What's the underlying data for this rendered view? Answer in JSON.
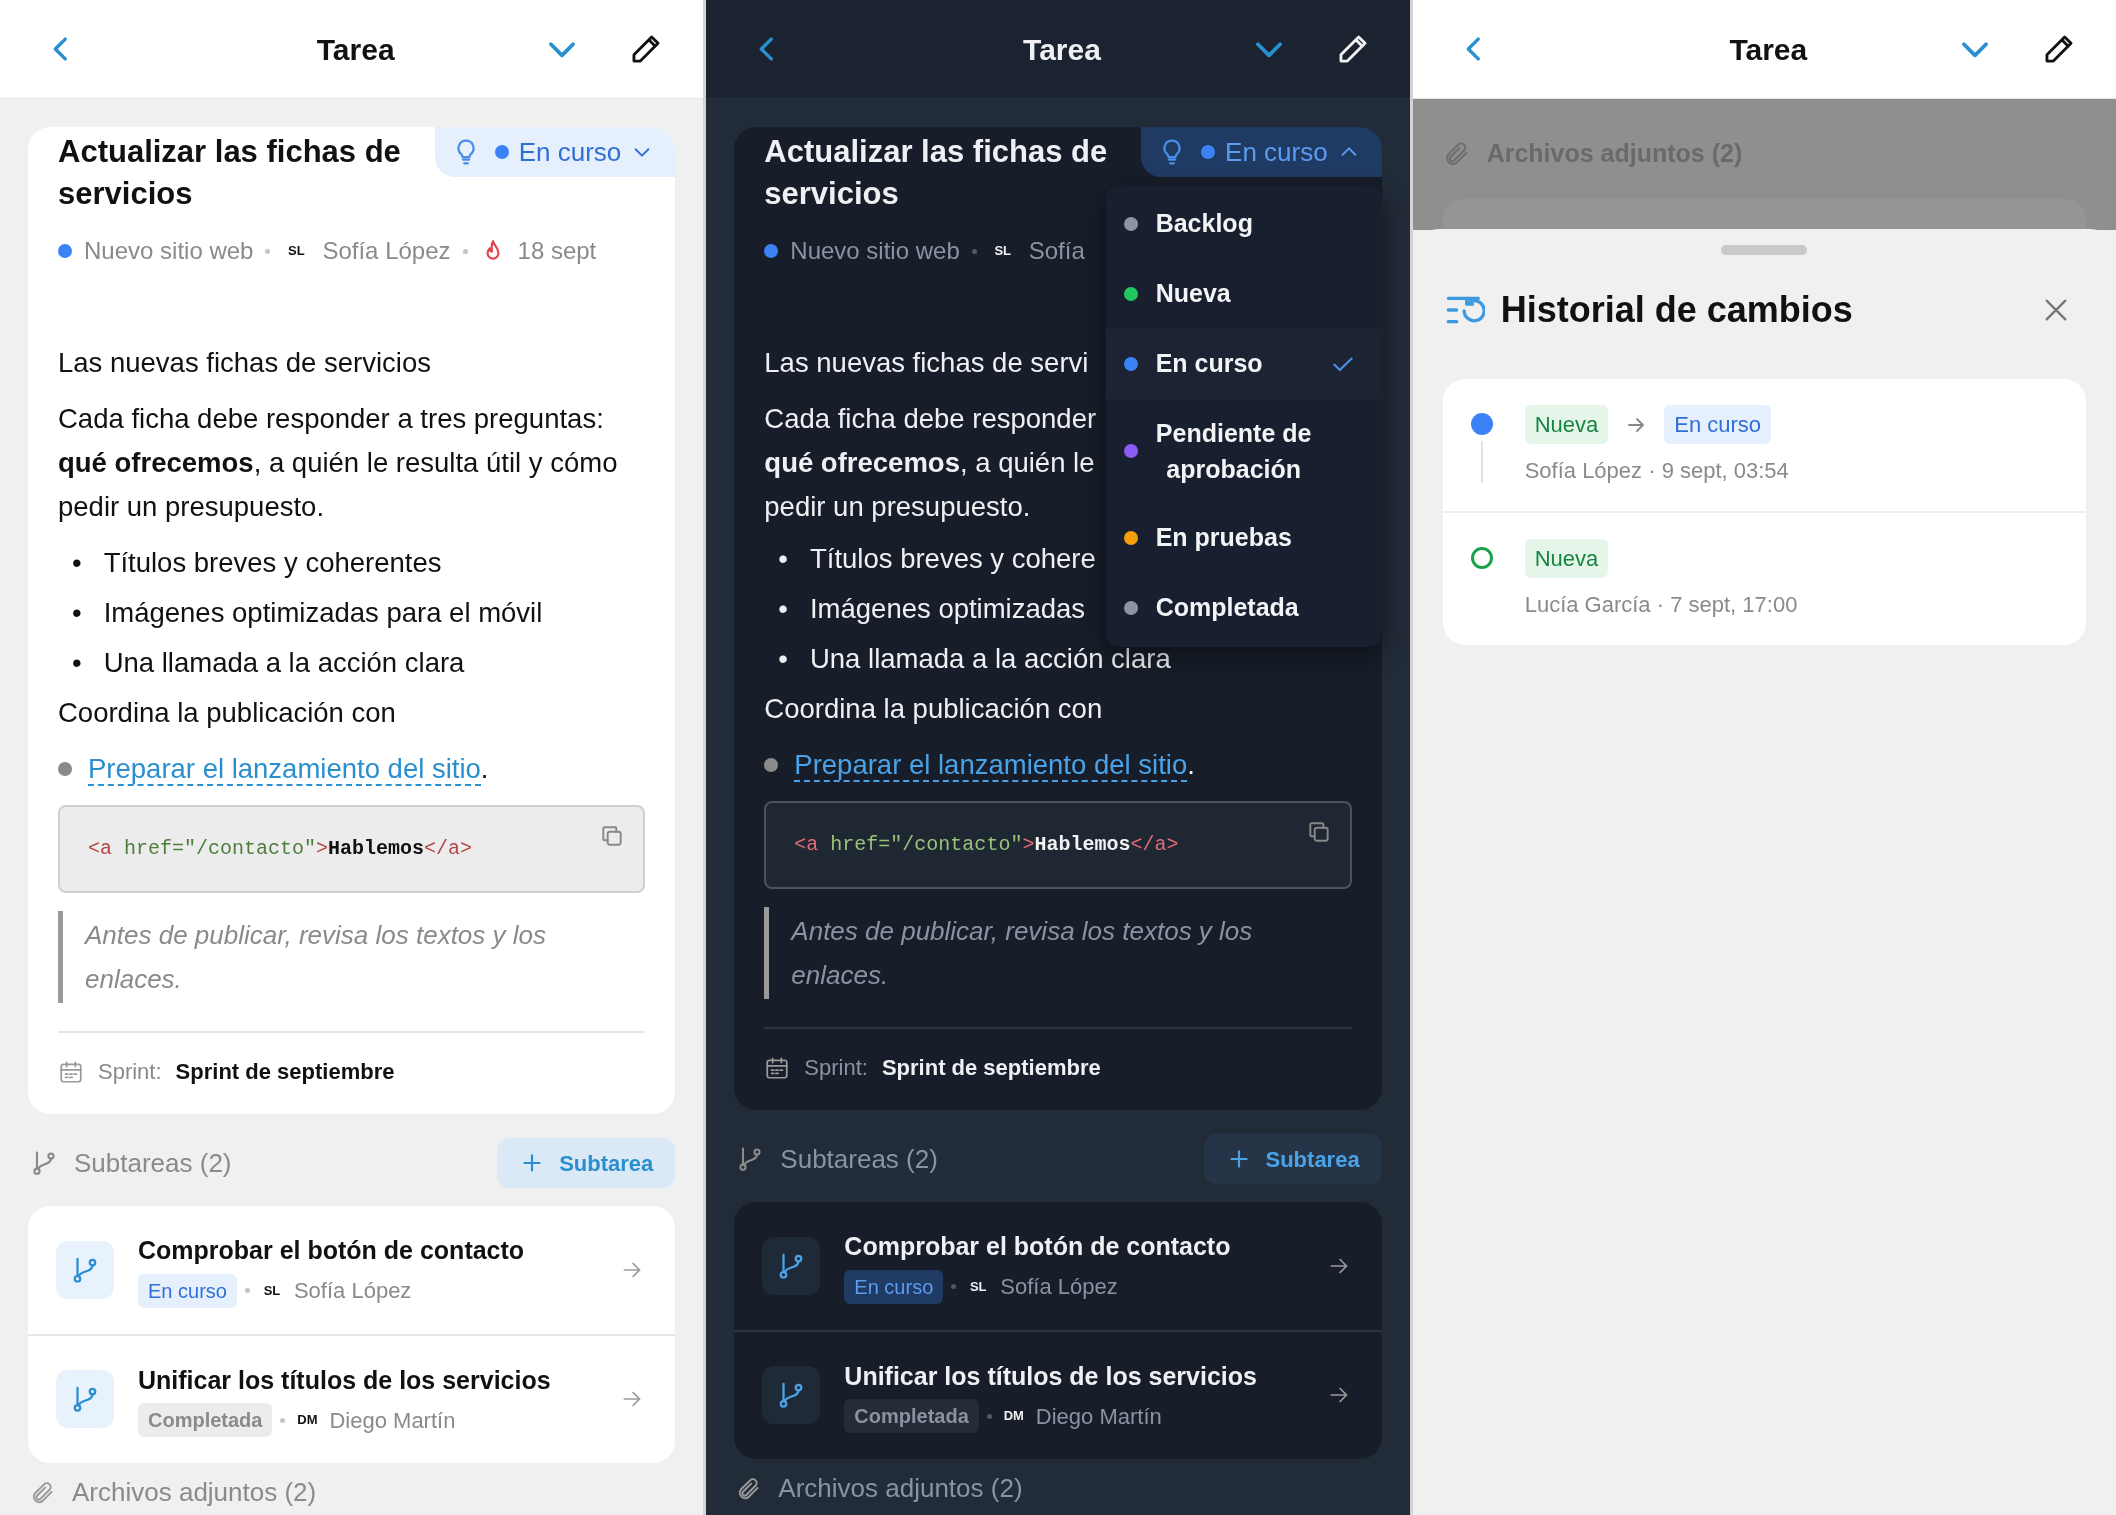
{
  "panels": [
    {
      "kind": "light_task",
      "header": {
        "title": "Tarea"
      },
      "task": {
        "title": "Actualizar las fichas de servicios",
        "status": {
          "label": "En curso",
          "color": "#3b82f6",
          "expanded": false
        },
        "project": {
          "label": "Nuevo sitio web",
          "color": "#3b82f6"
        },
        "assignee": {
          "initials": "SL",
          "name": "Sofía López"
        },
        "due": "18 sept",
        "blocks": [
          {
            "kind": "paragraph",
            "text": "Las nuevas fichas de servicios"
          },
          {
            "kind": "paragraph",
            "text": "Cada ficha debe responder a tres preguntas: **qué ofrecemos**, a quién le resulta útil y cómo pedir un presupuesto."
          },
          {
            "kind": "bullets",
            "marker": "•",
            "items": [
              "Títulos breves y coherentes",
              "Imágenes optimizadas para el móvil",
              "Una llamada a la acción clara"
            ]
          },
          {
            "kind": "paragraph",
            "text": "Coordina la publicación con"
          },
          {
            "kind": "link",
            "text": "Preparar el lanzamiento del sitio",
            "after": "."
          },
          {
            "kind": "code",
            "tokens": [
              {
                "kind": "tag",
                "text": "<a"
              },
              {
                "kind": "attr",
                "text": " href="
              },
              {
                "kind": "string",
                "text": "\"/contacto\""
              },
              {
                "kind": "tag",
                "text": ">"
              },
              {
                "kind": "plain",
                "text": "Hablemos"
              },
              {
                "kind": "tag",
                "text": "</a>"
              }
            ]
          },
          {
            "kind": "quote",
            "text": "Antes de publicar, revisa los textos y los enlaces."
          }
        ],
        "sprint": {
          "label": "Sprint:",
          "value": "Sprint de septiembre"
        }
      },
      "subtasks": {
        "heading": "Subtareas (2)",
        "add_label": "Subtarea",
        "items": [
          {
            "title": "Comprobar el botón de contacto",
            "status": {
              "label": "En curso",
              "kind": "in_progress"
            },
            "assignee": {
              "initials": "SL",
              "name": "Sofía López"
            }
          },
          {
            "title": "Unificar los títulos de los servicios",
            "status": {
              "label": "Completada",
              "kind": "done"
            },
            "assignee": {
              "initials": "DM",
              "name": "Diego Martín"
            }
          }
        ]
      },
      "attachments": {
        "heading": "Archivos adjuntos (2)"
      }
    },
    {
      "kind": "dark_task",
      "header": {
        "title": "Tarea"
      },
      "task": {
        "title": "Actualizar las fichas de servicios",
        "status": {
          "label": "En curso",
          "color": "#3b82f6",
          "expanded": true
        },
        "project": {
          "label": "Nuevo sitio web",
          "color": "#3b82f6"
        },
        "assignee": {
          "initials": "SL",
          "name": "Sofía"
        },
        "blocks": [
          {
            "kind": "paragraph",
            "text": "Las nuevas fichas de servi"
          },
          {
            "kind": "lines",
            "lines": [
              "Cada ficha debe responder",
              "**qué ofrecemos**, a quién le",
              "pedir un presupuesto."
            ]
          },
          {
            "kind": "bullets",
            "marker": "•",
            "items": [
              "Títulos breves y cohere",
              "Imágenes optimizadas",
              "Una llamada a la acción clara"
            ]
          },
          {
            "kind": "paragraph",
            "text": "Coordina la publicación con"
          },
          {
            "kind": "link",
            "text": "Preparar el lanzamiento del sitio",
            "after": "."
          },
          {
            "kind": "code",
            "tokens": [
              {
                "kind": "tag",
                "text": "<a"
              },
              {
                "kind": "attr",
                "text": " href="
              },
              {
                "kind": "string",
                "text": "\"/contacto\""
              },
              {
                "kind": "tag",
                "text": ">"
              },
              {
                "kind": "plain",
                "text": "Hablemos"
              },
              {
                "kind": "tag",
                "text": "</a>"
              }
            ]
          },
          {
            "kind": "quote",
            "text": "Antes de publicar, revisa los textos y los enlaces."
          }
        ],
        "sprint": {
          "label": "Sprint:",
          "value": "Sprint de septiembre"
        },
        "status_menu": {
          "items": [
            {
              "label": "Backlog",
              "color": "#8a94a6",
              "selected": false
            },
            {
              "label": "Nueva",
              "color": "#22c55e",
              "selected": false
            },
            {
              "label": "En curso",
              "color": "#3b82f6",
              "selected": true
            },
            {
              "label": "Pendiente de aprobación",
              "color": "#8b5cf6",
              "selected": false
            },
            {
              "label": "En pruebas",
              "color": "#f59e0b",
              "selected": false
            },
            {
              "label": "Completada",
              "color": "#8a94a6",
              "selected": false
            }
          ]
        }
      },
      "subtasks": {
        "heading": "Subtareas (2)",
        "add_label": "Subtarea",
        "items": [
          {
            "title": "Comprobar el botón de contacto",
            "status": {
              "label": "En curso",
              "kind": "in_progress"
            },
            "assignee": {
              "initials": "SL",
              "name": "Sofía López"
            }
          },
          {
            "title": "Unificar los títulos de los servicios",
            "status": {
              "label": "Completada",
              "kind": "done"
            },
            "assignee": {
              "initials": "DM",
              "name": "Diego Martín"
            }
          }
        ]
      },
      "attachments": {
        "heading": "Archivos adjuntos (2)"
      }
    },
    {
      "kind": "history",
      "header": {
        "title": "Tarea"
      },
      "backdrop": {
        "heading": "Archivos adjuntos (2)"
      },
      "sheet": {
        "title": "Historial de cambios",
        "entries": [
          {
            "kind": "change",
            "color": "#3b82f6",
            "chips": [
              {
                "label": "Nueva",
                "kind": "new"
              },
              {
                "label": "En curso",
                "kind": "in_progress"
              }
            ],
            "meta": "Sofía López · 9 sept, 03:54"
          },
          {
            "kind": "created",
            "color": "#16a34a",
            "chips": [
              {
                "label": "Nueva",
                "kind": "new"
              }
            ],
            "meta": "Lucía García · 7 sept, 17:00"
          }
        ]
      }
    }
  ]
}
